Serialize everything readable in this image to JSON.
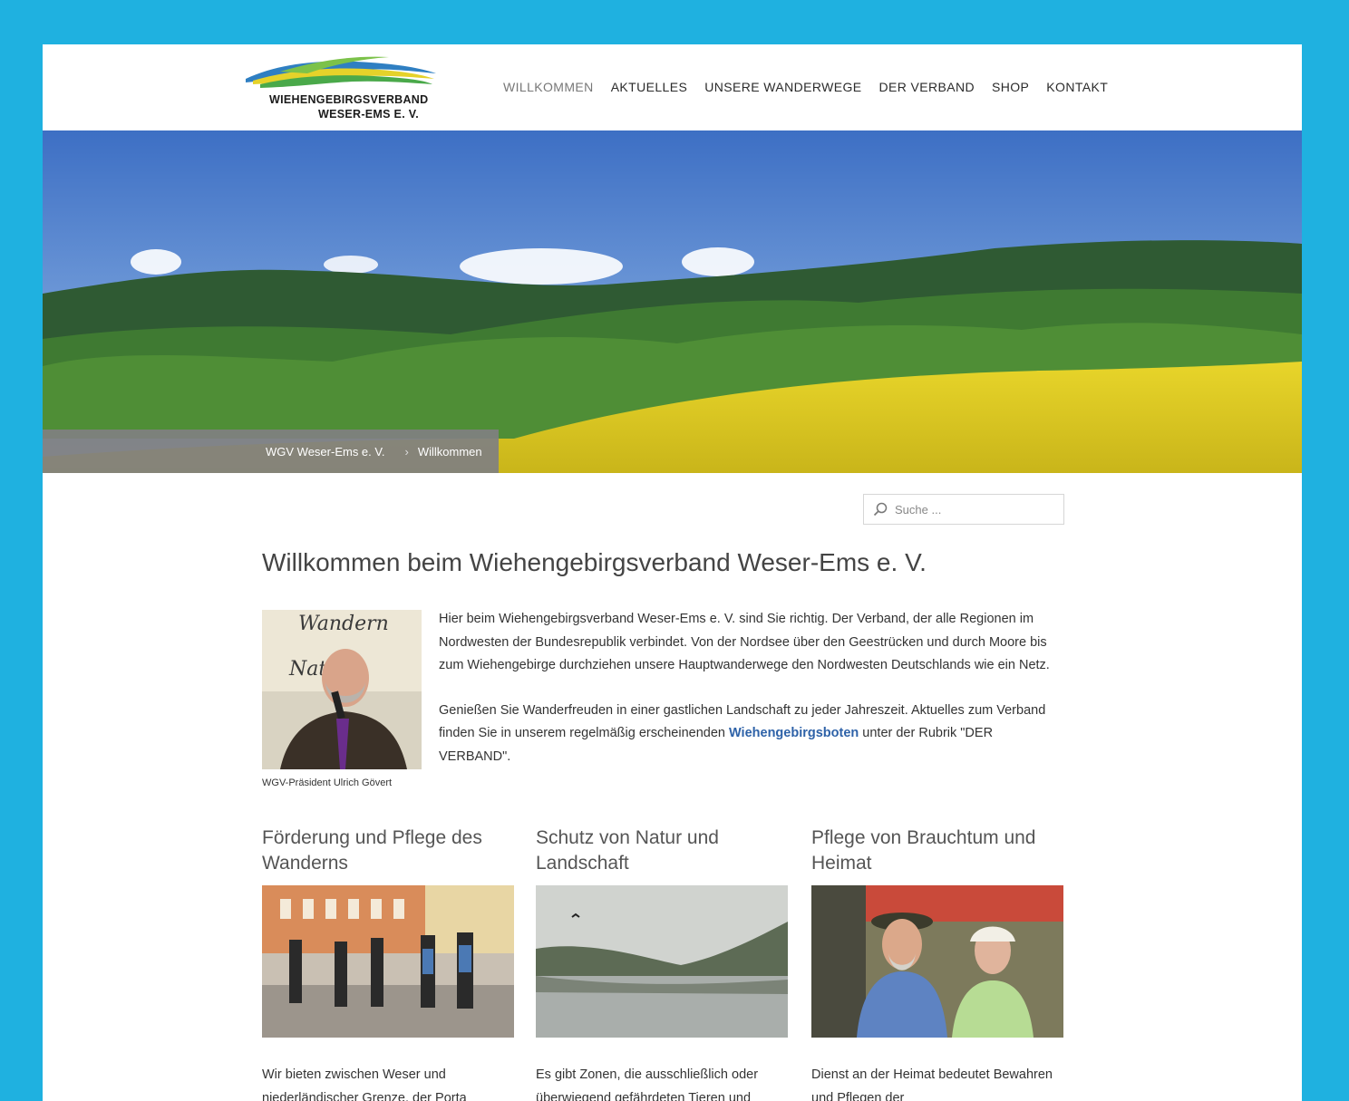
{
  "logo": {
    "line1": "WIEHENGEBIRGSVERBAND",
    "line2": "WESER-EMS E. V."
  },
  "nav": {
    "items": [
      {
        "label": "WILLKOMMEN",
        "active": true
      },
      {
        "label": "AKTUELLES"
      },
      {
        "label": "UNSERE WANDERWEGE"
      },
      {
        "label": "DER VERBAND"
      },
      {
        "label": "SHOP"
      },
      {
        "label": "KONTAKT"
      }
    ]
  },
  "breadcrumb": {
    "home": "WGV Weser-Ems e. V.",
    "current": "Willkommen"
  },
  "search": {
    "placeholder": "Suche ..."
  },
  "main": {
    "title": "Willkommen beim Wiehengebirgsverband Weser-Ems e. V.",
    "caption": "WGV-Präsident Ulrich Gövert",
    "paragraph1": "Hier beim Wiehengebirgsverband Weser-Ems e. V. sind Sie richtig. Der Verband, der alle Regionen im Nordwesten der Bundesrepublik verbindet. Von der Nordsee über den Geestrücken und durch Moore bis zum Wiehengebirge durchziehen unsere Hauptwanderwege den Nordwesten Deutschlands wie ein Netz.",
    "paragraph2_before": "Genießen Sie Wanderfreuden in einer gastlichen Landschaft zu jeder Jahreszeit. Aktuelles zum Verband finden Sie in unserem regelmäßig erscheinenden ",
    "paragraph2_link": "Wiehengebirgsboten",
    "paragraph2_after": " unter der Rubrik \"DER VERBAND\"."
  },
  "columns": [
    {
      "title": "Förderung und Pflege des Wanderns",
      "text": "Wir bieten zwischen Weser und niederländischer Grenze, der Porta"
    },
    {
      "title": "Schutz von Natur und Landschaft",
      "text": "Es gibt Zonen, die ausschließlich oder überwiegend gefährdeten Tieren und"
    },
    {
      "title": "Pflege von Brauchtum und Heimat",
      "text": "Dienst an der Heimat bedeutet Bewahren und Pflegen der"
    }
  ],
  "colors": {
    "frame_bg": "#1fb1e0",
    "link": "#2e62a8",
    "breadcrumb_bg": "#808080"
  }
}
